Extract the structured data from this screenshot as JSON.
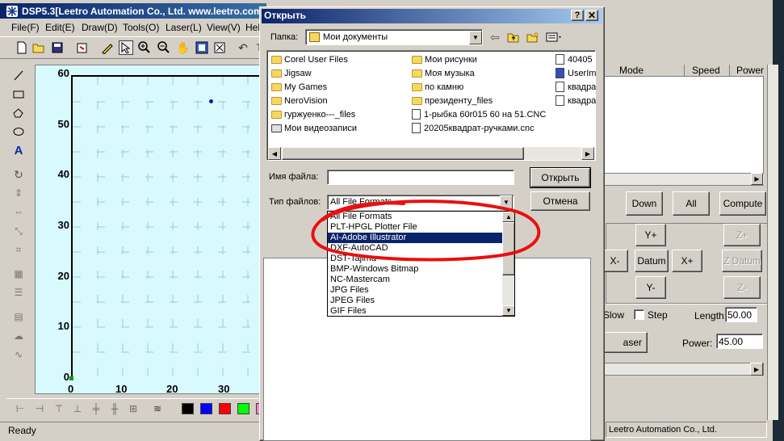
{
  "app": {
    "title": "DSP5.3[Leetro Automation Co., Ltd. www.leetro.com",
    "menu": [
      "File(F)",
      "Edit(E)",
      "Draw(D)",
      "Tools(O)",
      "Laser(L)",
      "View(V)",
      "Hel"
    ],
    "status_left": "Ready",
    "status_right": "Leetro Automation Co., Ltd.",
    "colors": {
      "titlebar": "#0a246a",
      "canvas": "#d8fafe",
      "accent_point": "#1414c8"
    },
    "palette": [
      "#000000",
      "#0000ff",
      "#ff0000",
      "#00ff00"
    ]
  },
  "canvas": {
    "y_ticks": [
      "60",
      "50",
      "40",
      "30",
      "20",
      "10",
      "0"
    ],
    "x_ticks": [
      "0",
      "10",
      "20",
      "30"
    ]
  },
  "right_panel": {
    "columns": [
      "Mode",
      "Speed",
      "Power"
    ],
    "buttons_row1": [
      "Down",
      "All",
      "Compute"
    ],
    "jog": {
      "y_plus": "Y+",
      "x_minus": "X-",
      "datum": "Datum",
      "x_plus": "X+",
      "y_minus": "Y-",
      "z_plus": "Z+",
      "z_datum": "Z Datum",
      "z_minus": "Z-"
    },
    "slow_label": "Slow",
    "step_label": "Step",
    "length_label": "Length:",
    "length_value": "50.00",
    "laser_label": "aser",
    "power_label": "Power:",
    "power_value": "45.00"
  },
  "dialog": {
    "title": "Открыть",
    "folder_label": "Папка:",
    "folder_value": "Мои документы",
    "files_col1": [
      "Corel User Files",
      "Jigsaw",
      "My Games",
      "NeroVision",
      "гуржуенко---_files",
      "Мои видеозаписи"
    ],
    "files_col2": [
      "Мои рисунки",
      "Моя музыка",
      "по камню",
      "президенту_files",
      "1-рыбка 60r015 60 на 51.CNC",
      "20205квадрат-ручками.cnc"
    ],
    "files_col3": [
      "40405",
      "UserIm",
      "квадра",
      "квадра"
    ],
    "filename_label": "Имя файла:",
    "filename_value": "",
    "filetype_label": "Тип файлов:",
    "filetype_value": "All File Formats",
    "open_button": "Открыть",
    "cancel_button": "Отмена",
    "filetype_options": [
      "All File Formats",
      "PLT-HPGL Plotter File",
      "AI-Adobe Illustrator",
      "DXF-AutoCAD",
      "DST-Tajima",
      "BMP-Windows Bitmap",
      "NC-Mastercam",
      "JPG Files",
      "JPEG Files",
      "GIF Files"
    ],
    "selected_option_index": 2
  }
}
